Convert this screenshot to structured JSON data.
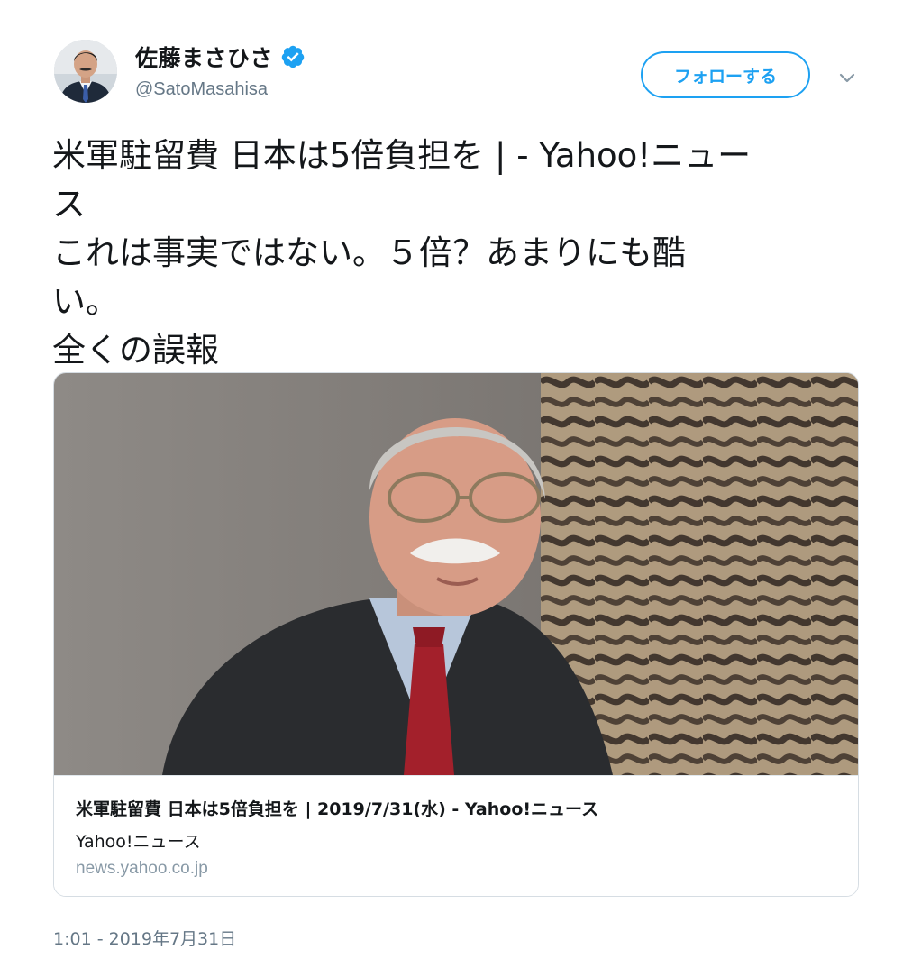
{
  "author": {
    "display_name": "佐藤まさひさ",
    "handle": "@SatoMasahisa",
    "verified": true
  },
  "actions": {
    "follow_label": "フォローする"
  },
  "tweet": {
    "lines": [
      "米軍駐留費 日本は5倍負担を | - Yahoo!ニュー",
      "ス",
      "これは事実ではない。５倍？あまりにも酷",
      "い。",
      "全くの誤報"
    ],
    "timestamp": "1:01 - 2019年7月31日"
  },
  "card": {
    "title": "米軍駐留費 日本は5倍負担を | 2019/7/31(水) - Yahoo!ニュース",
    "description": "Yahoo!ニュース",
    "domain": "news.yahoo.co.jp"
  },
  "colors": {
    "accent": "#1da1f2",
    "text": "#14171a",
    "secondary": "#657786",
    "muted": "#8899a6",
    "border": "#d6dde3"
  },
  "icons": {
    "verified": "verified-badge-icon",
    "caret": "chevron-down-icon"
  }
}
